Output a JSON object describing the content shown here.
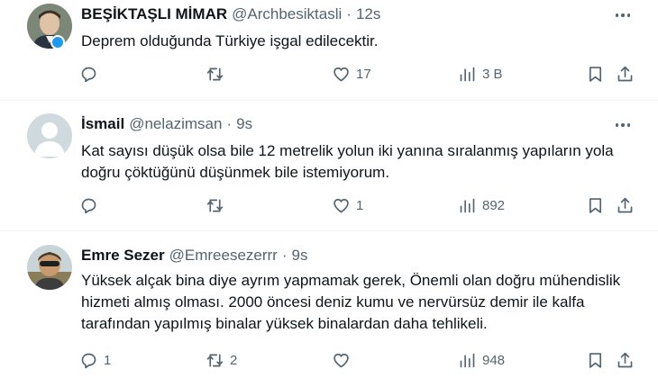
{
  "tweets": [
    {
      "name": "BEŞİKTAŞLI MİMAR",
      "handle": "@Archbesiktasli",
      "sep": "·",
      "time": "12s",
      "text": "Deprem olduğunda Türkiye işgal edilecektir.",
      "replies": "",
      "retweets": "",
      "likes": "17",
      "views": "3 B"
    },
    {
      "name": "İsmail",
      "handle": "@nelazimsan",
      "sep": "·",
      "time": "9s",
      "text": "Kat sayısı düşük olsa bile 12 metrelik yolun iki yanına sıralanmış yapıların yola doğru çöktüğünü düşünmek bile istemiyorum.",
      "replies": "",
      "retweets": "",
      "likes": "1",
      "views": "892"
    },
    {
      "name": "Emre Sezer",
      "handle": "@Emreesezerrr",
      "sep": "·",
      "time": "9s",
      "text": "Yüksek alçak bina diye ayrım yapmamak gerek, Önemli olan doğru mühendislik hizmeti almış olması. 2000 öncesi deniz kumu ve nervürsüz demir ile kalfa tarafından yapılmış binalar yüksek binalardan daha tehlikeli.",
      "replies": "1",
      "retweets": "2",
      "likes": "",
      "views": "948"
    }
  ],
  "colors": {
    "text": "#0f1419",
    "secondary": "#536471",
    "divider": "#eff3f4",
    "verified": "#1d9bf0"
  },
  "icons": [
    "reply-icon",
    "retweet-icon",
    "like-icon",
    "views-icon",
    "bookmark-icon",
    "share-icon",
    "more-icon"
  ]
}
